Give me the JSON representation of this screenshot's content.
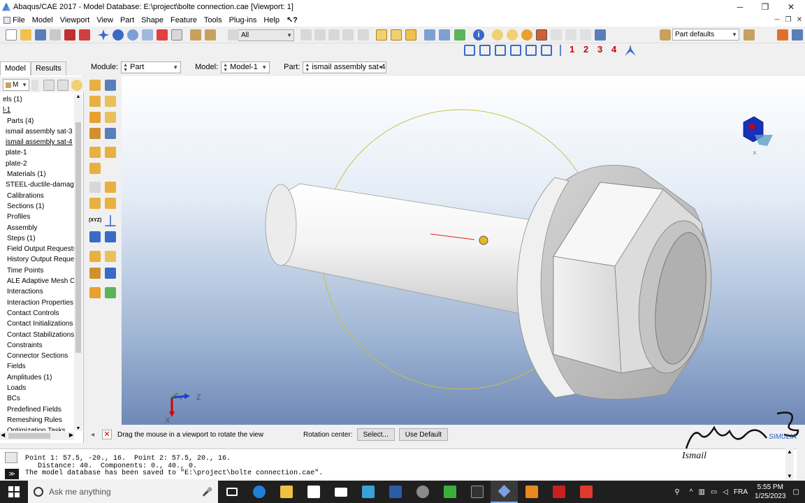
{
  "window": {
    "title": "Abaqus/CAE 2017 - Model Database: E:\\project\\bolte connection.cae [Viewport: 1]",
    "minimize": "─",
    "restore": "❐",
    "close": "✕"
  },
  "menu": {
    "items": [
      "File",
      "Model",
      "Viewport",
      "View",
      "Part",
      "Shape",
      "Feature",
      "Tools",
      "Plug-ins",
      "Help"
    ],
    "help_cursor": "↖?"
  },
  "toolbar": {
    "selection_filter": "All",
    "render_style": "Part defaults",
    "triad_numbers": [
      "1",
      "2",
      "3",
      "4"
    ]
  },
  "context": {
    "module_label": "Module:",
    "module_value": "Part",
    "model_label": "Model:",
    "model_value": "Model-1",
    "part_label": "Part:",
    "part_value": "ismail assembly sat-4"
  },
  "tree": {
    "tabs": [
      "Model",
      "Results"
    ],
    "filter_value": "M",
    "items": [
      {
        "label": "els (1)",
        "indent": 0
      },
      {
        "label": "l-1",
        "indent": 0,
        "selected": true
      },
      {
        "label": "Parts (4)",
        "indent": 1
      },
      {
        "label": "ismail assembly sat-3",
        "indent": 2
      },
      {
        "label": "ismail assembly sat-4",
        "indent": 2,
        "selected": true
      },
      {
        "label": "plate-1",
        "indent": 2
      },
      {
        "label": "plate-2",
        "indent": 2
      },
      {
        "label": "Materials (1)",
        "indent": 1
      },
      {
        "label": "STEEL-ductile-damage",
        "indent": 2
      },
      {
        "label": "Calibrations",
        "indent": 1
      },
      {
        "label": "Sections (1)",
        "indent": 1
      },
      {
        "label": "Profiles",
        "indent": 1
      },
      {
        "label": "Assembly",
        "indent": 1
      },
      {
        "label": "Steps (1)",
        "indent": 1
      },
      {
        "label": "Field Output Requests",
        "indent": 1
      },
      {
        "label": "History Output Reques",
        "indent": 1
      },
      {
        "label": "Time Points",
        "indent": 1
      },
      {
        "label": "ALE Adaptive Mesh Cc",
        "indent": 1
      },
      {
        "label": "Interactions",
        "indent": 1
      },
      {
        "label": "Interaction Properties",
        "indent": 1
      },
      {
        "label": "Contact Controls",
        "indent": 1
      },
      {
        "label": "Contact Initializations",
        "indent": 1
      },
      {
        "label": "Contact Stabilizations",
        "indent": 1
      },
      {
        "label": "Constraints",
        "indent": 1
      },
      {
        "label": "Connector Sections",
        "indent": 1
      },
      {
        "label": "Fields",
        "indent": 1
      },
      {
        "label": "Amplitudes (1)",
        "indent": 1
      },
      {
        "label": "Loads",
        "indent": 1
      },
      {
        "label": "BCs",
        "indent": 1
      },
      {
        "label": "Predefined Fields",
        "indent": 1
      },
      {
        "label": "Remeshing Rules",
        "indent": 1
      },
      {
        "label": "Optimization Tasks",
        "indent": 1
      }
    ]
  },
  "toolbox": {
    "xyz_label": "(XYZ)"
  },
  "viewport": {
    "triad_labels": {
      "x": "X",
      "y": "Y",
      "z": "Z"
    },
    "mini_triad_x": "x"
  },
  "prompt": {
    "text": "Drag the mouse in a viewport to rotate the view",
    "rotation_center_label": "Rotation center:",
    "select_button": "Select...",
    "default_button": "Use Default"
  },
  "messages": {
    "lines": [
      "Point 1: 57.5, -20., 16.  Point 2: 57.5, 20., 16.",
      "   Distance: 40.  Components: 0., 40., 0.",
      "The model database has been saved to \"E:\\project\\bolte connection.cae\"."
    ]
  },
  "watermark": {
    "signature": "Ismail",
    "brand": "SIMULIA"
  },
  "taskbar": {
    "search_placeholder": "Ask me anything",
    "language": "FRA",
    "time": "5:55 PM",
    "date": "1/25/2023"
  },
  "colors": {
    "accent": "#1f5fbf",
    "taskbar": "#1f1f1f",
    "triad_x": "#d80000",
    "triad_y": "#1aa01a",
    "triad_z": "#1a3fd8"
  }
}
